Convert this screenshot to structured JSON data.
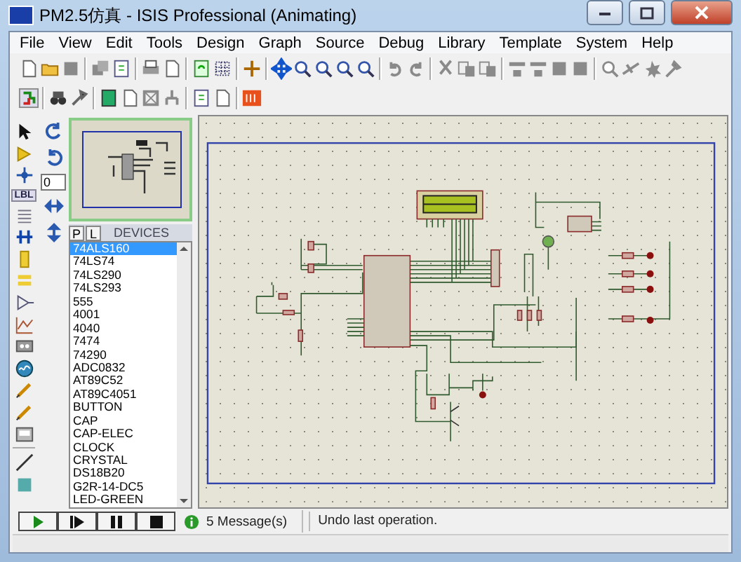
{
  "window": {
    "title": "PM2.5仿真 - ISIS Professional (Animating)"
  },
  "menu": [
    "File",
    "View",
    "Edit",
    "Tools",
    "Design",
    "Graph",
    "Source",
    "Debug",
    "Library",
    "Template",
    "System",
    "Help"
  ],
  "label_tool": "LBL",
  "rotation": {
    "value": "0"
  },
  "device_panel": {
    "tabs": [
      {
        "label": "P",
        "selected": false
      },
      {
        "label": "L",
        "selected": false
      }
    ],
    "title": "DEVICES",
    "items": [
      {
        "label": "74ALS160",
        "selected": true
      },
      {
        "label": "74LS74",
        "selected": false
      },
      {
        "label": "74LS290",
        "selected": false
      },
      {
        "label": "74LS293",
        "selected": false
      },
      {
        "label": "555",
        "selected": false
      },
      {
        "label": "4001",
        "selected": false
      },
      {
        "label": "4040",
        "selected": false
      },
      {
        "label": "7474",
        "selected": false
      },
      {
        "label": "74290",
        "selected": false
      },
      {
        "label": "ADC0832",
        "selected": false
      },
      {
        "label": "AT89C52",
        "selected": false
      },
      {
        "label": "AT89C4051",
        "selected": false
      },
      {
        "label": "BUTTON",
        "selected": false
      },
      {
        "label": "CAP",
        "selected": false
      },
      {
        "label": "CAP-ELEC",
        "selected": false
      },
      {
        "label": "CLOCK",
        "selected": false
      },
      {
        "label": "CRYSTAL",
        "selected": false
      },
      {
        "label": "DS18B20",
        "selected": false
      },
      {
        "label": "G2R-14-DC5",
        "selected": false
      },
      {
        "label": "LED-GREEN",
        "selected": false
      }
    ]
  },
  "messages": "5 Message(s)",
  "status_text": "Undo last operation."
}
